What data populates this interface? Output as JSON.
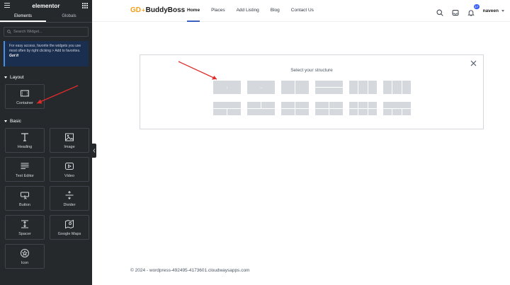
{
  "panel": {
    "logo": "elementor",
    "tabs": [
      {
        "label": "Elements",
        "active": true
      },
      {
        "label": "Globals",
        "active": false
      }
    ],
    "search_placeholder": "Search Widget...",
    "notice": {
      "text": "For easy access, favorite the widgets you use most often by right clicking > Add to favorites.",
      "cta": "Got It"
    },
    "sections": [
      {
        "title": "Layout",
        "widgets": [
          {
            "label": "Container",
            "icon": "container-icon"
          }
        ]
      },
      {
        "title": "Basic",
        "widgets": [
          {
            "label": "Heading",
            "icon": "heading-icon"
          },
          {
            "label": "Image",
            "icon": "image-icon"
          },
          {
            "label": "Text Editor",
            "icon": "text-editor-icon"
          },
          {
            "label": "Video",
            "icon": "video-icon"
          },
          {
            "label": "Button",
            "icon": "button-icon"
          },
          {
            "label": "Divider",
            "icon": "divider-icon"
          },
          {
            "label": "Spacer",
            "icon": "spacer-icon"
          },
          {
            "label": "Google Maps",
            "icon": "google-maps-icon"
          },
          {
            "label": "Icon",
            "icon": "star-icon"
          }
        ]
      }
    ]
  },
  "site": {
    "brand": {
      "part1": "GD",
      "plus": "+",
      "part2": "BuddyBoss"
    },
    "nav": [
      {
        "label": "Home",
        "active": true
      },
      {
        "label": "Places",
        "active": false
      },
      {
        "label": "Add Listing",
        "active": false
      },
      {
        "label": "Blog",
        "active": false
      },
      {
        "label": "Contact Us",
        "active": false
      }
    ],
    "notifications_count": "17",
    "user_name": "naveen",
    "accent_color": "#385dff",
    "brand_color": "#f59c1a"
  },
  "structure": {
    "title": "Select your structure"
  },
  "footer": {
    "text": "© 2024 - wordpress-492495-4173601.cloudwaysapps.com"
  }
}
